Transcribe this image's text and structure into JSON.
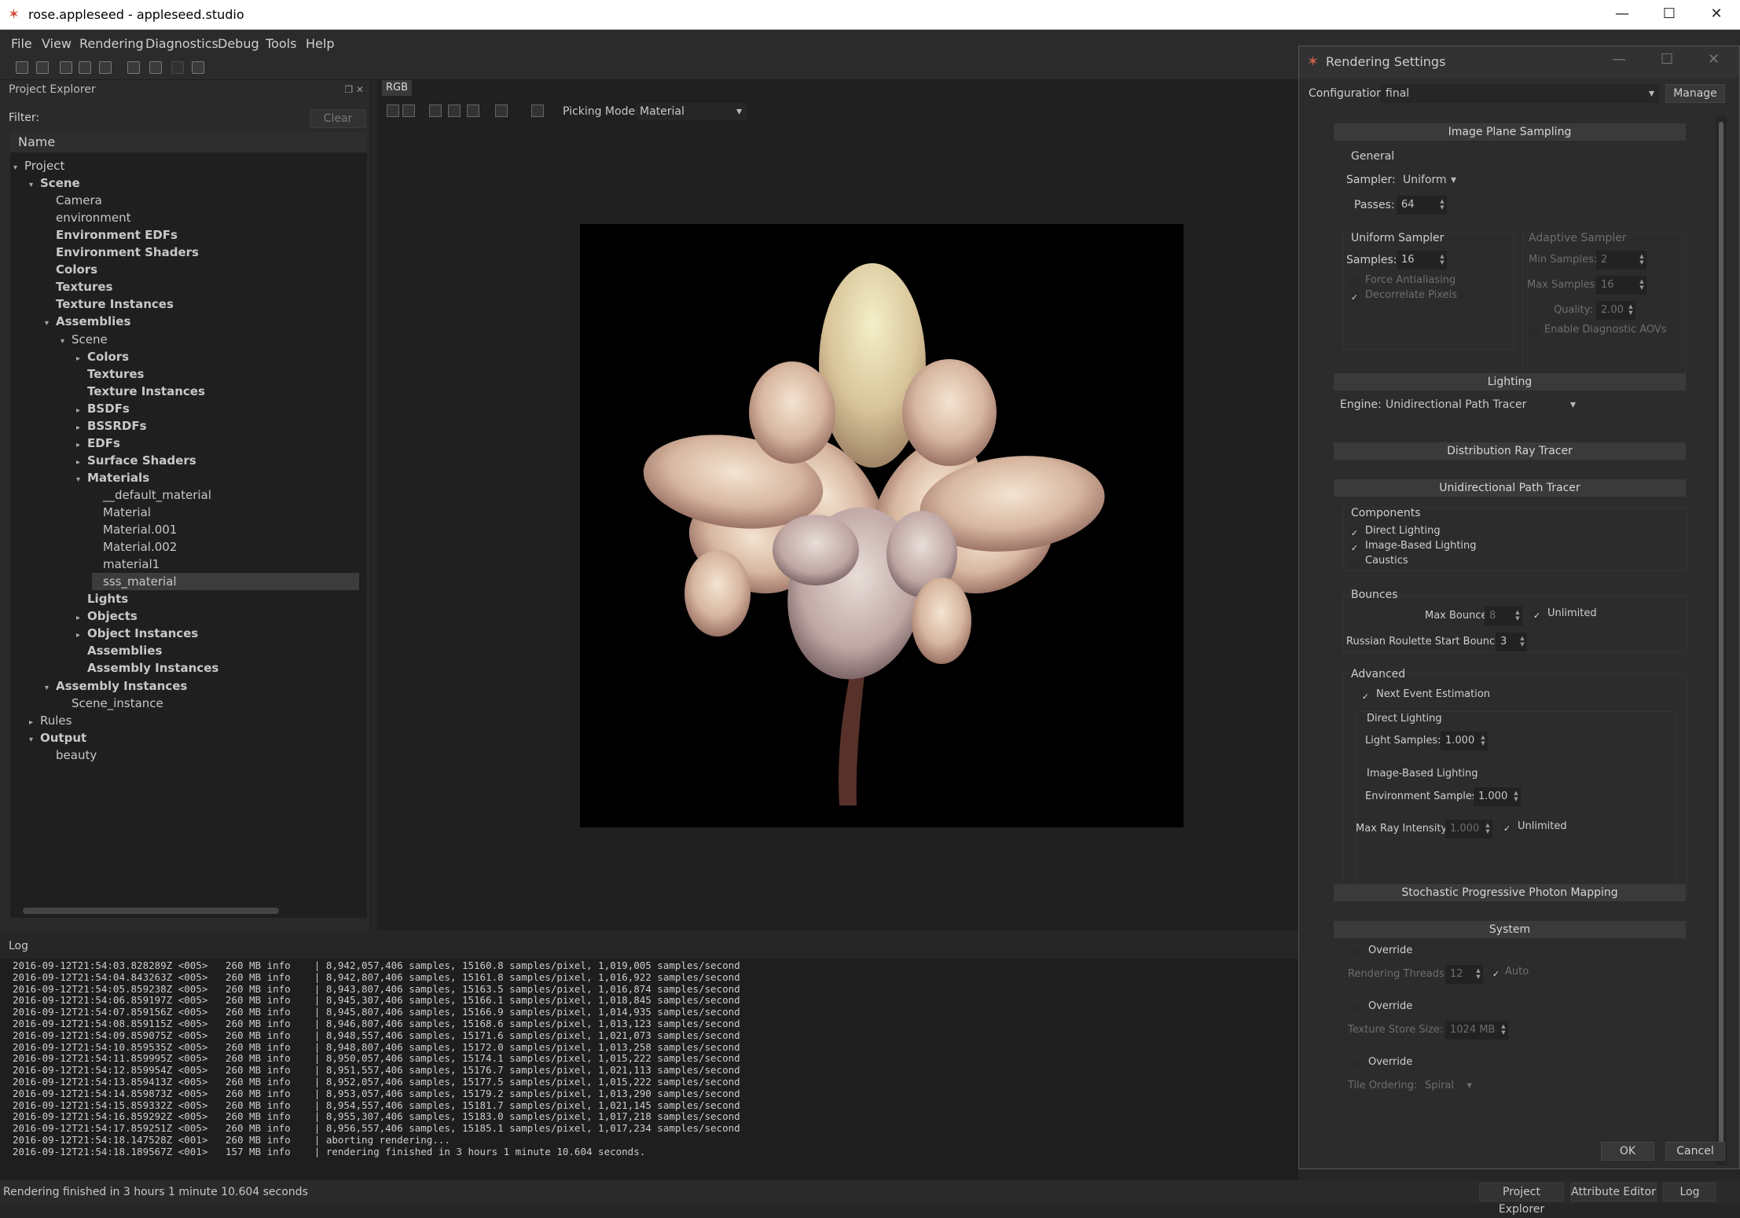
{
  "window": {
    "title": "rose.appleseed - appleseed.studio",
    "min": "—",
    "max": "☐",
    "close": "✕"
  },
  "menu": [
    "File",
    "View",
    "Rendering",
    "Diagnostics",
    "Debug",
    "Tools",
    "Help"
  ],
  "project_explorer": {
    "title": "Project Explorer",
    "filter_label": "Filter:",
    "filter_value": "",
    "clear_label": "Clear",
    "column": "Name",
    "tree": [
      {
        "label": "Project",
        "bold": false,
        "depth": 0,
        "arrow": "▾"
      },
      {
        "label": "Scene",
        "bold": true,
        "depth": 1,
        "arrow": "▾"
      },
      {
        "label": "Camera",
        "bold": false,
        "depth": 2,
        "arrow": ""
      },
      {
        "label": "environment",
        "bold": false,
        "depth": 2,
        "arrow": ""
      },
      {
        "label": "Environment EDFs",
        "bold": true,
        "depth": 2,
        "arrow": ""
      },
      {
        "label": "Environment Shaders",
        "bold": true,
        "depth": 2,
        "arrow": ""
      },
      {
        "label": "Colors",
        "bold": true,
        "depth": 2,
        "arrow": ""
      },
      {
        "label": "Textures",
        "bold": true,
        "depth": 2,
        "arrow": ""
      },
      {
        "label": "Texture Instances",
        "bold": true,
        "depth": 2,
        "arrow": ""
      },
      {
        "label": "Assemblies",
        "bold": true,
        "depth": 2,
        "arrow": "▾"
      },
      {
        "label": "Scene",
        "bold": false,
        "depth": 3,
        "arrow": "▾"
      },
      {
        "label": "Colors",
        "bold": true,
        "depth": 4,
        "arrow": "▸"
      },
      {
        "label": "Textures",
        "bold": true,
        "depth": 4,
        "arrow": ""
      },
      {
        "label": "Texture Instances",
        "bold": true,
        "depth": 4,
        "arrow": ""
      },
      {
        "label": "BSDFs",
        "bold": true,
        "depth": 4,
        "arrow": "▸"
      },
      {
        "label": "BSSRDFs",
        "bold": true,
        "depth": 4,
        "arrow": "▸"
      },
      {
        "label": "EDFs",
        "bold": true,
        "depth": 4,
        "arrow": "▸"
      },
      {
        "label": "Surface Shaders",
        "bold": true,
        "depth": 4,
        "arrow": "▸"
      },
      {
        "label": "Materials",
        "bold": true,
        "depth": 4,
        "arrow": "▾"
      },
      {
        "label": "__default_material",
        "bold": false,
        "depth": 5,
        "arrow": ""
      },
      {
        "label": "Material",
        "bold": false,
        "depth": 5,
        "arrow": ""
      },
      {
        "label": "Material.001",
        "bold": false,
        "depth": 5,
        "arrow": ""
      },
      {
        "label": "Material.002",
        "bold": false,
        "depth": 5,
        "arrow": ""
      },
      {
        "label": "material1",
        "bold": false,
        "depth": 5,
        "arrow": ""
      },
      {
        "label": "sss_material",
        "bold": false,
        "depth": 5,
        "arrow": "",
        "selected": true
      },
      {
        "label": "Lights",
        "bold": true,
        "depth": 4,
        "arrow": ""
      },
      {
        "label": "Objects",
        "bold": true,
        "depth": 4,
        "arrow": "▸"
      },
      {
        "label": "Object Instances",
        "bold": true,
        "depth": 4,
        "arrow": "▸"
      },
      {
        "label": "Assemblies",
        "bold": true,
        "depth": 4,
        "arrow": ""
      },
      {
        "label": "Assembly Instances",
        "bold": true,
        "depth": 4,
        "arrow": ""
      },
      {
        "label": "Assembly Instances",
        "bold": true,
        "depth": 2,
        "arrow": "▾"
      },
      {
        "label": "Scene_instance",
        "bold": false,
        "depth": 3,
        "arrow": ""
      },
      {
        "label": "Rules",
        "bold": false,
        "depth": 1,
        "arrow": "▸"
      },
      {
        "label": "Output",
        "bold": true,
        "depth": 1,
        "arrow": "▾"
      },
      {
        "label": "beauty",
        "bold": false,
        "depth": 2,
        "arrow": ""
      }
    ]
  },
  "viewport": {
    "tab": "RGB",
    "picking_label": "Picking Mode:",
    "picking_value": "Material"
  },
  "log": {
    "title": "Log",
    "lines": [
      "2016-09-12T21:54:03.828289Z <005>   260 MB info    | 8,942,057,406 samples, 15160.8 samples/pixel, 1,019,005 samples/second",
      "2016-09-12T21:54:04.843263Z <005>   260 MB info    | 8,942,807,406 samples, 15161.8 samples/pixel, 1,016,922 samples/second",
      "2016-09-12T21:54:05.859238Z <005>   260 MB info    | 8,943,807,406 samples, 15163.5 samples/pixel, 1,016,874 samples/second",
      "2016-09-12T21:54:06.859197Z <005>   260 MB info    | 8,945,307,406 samples, 15166.1 samples/pixel, 1,018,845 samples/second",
      "2016-09-12T21:54:07.859156Z <005>   260 MB info    | 8,945,807,406 samples, 15166.9 samples/pixel, 1,014,935 samples/second",
      "2016-09-12T21:54:08.859115Z <005>   260 MB info    | 8,946,807,406 samples, 15168.6 samples/pixel, 1,013,123 samples/second",
      "2016-09-12T21:54:09.859075Z <005>   260 MB info    | 8,948,557,406 samples, 15171.6 samples/pixel, 1,021,073 samples/second",
      "2016-09-12T21:54:10.859535Z <005>   260 MB info    | 8,948,807,406 samples, 15172.0 samples/pixel, 1,013,258 samples/second",
      "2016-09-12T21:54:11.859995Z <005>   260 MB info    | 8,950,057,406 samples, 15174.1 samples/pixel, 1,015,222 samples/second",
      "2016-09-12T21:54:12.859954Z <005>   260 MB info    | 8,951,557,406 samples, 15176.7 samples/pixel, 1,021,113 samples/second",
      "2016-09-12T21:54:13.859413Z <005>   260 MB info    | 8,952,057,406 samples, 15177.5 samples/pixel, 1,015,222 samples/second",
      "2016-09-12T21:54:14.859873Z <005>   260 MB info    | 8,953,057,406 samples, 15179.2 samples/pixel, 1,013,290 samples/second",
      "2016-09-12T21:54:15.859332Z <005>   260 MB info    | 8,954,557,406 samples, 15181.7 samples/pixel, 1,021,145 samples/second",
      "2016-09-12T21:54:16.859292Z <005>   260 MB info    | 8,955,307,406 samples, 15183.0 samples/pixel, 1,017,218 samples/second",
      "2016-09-12T21:54:17.859251Z <005>   260 MB info    | 8,956,557,406 samples, 15185.1 samples/pixel, 1,017,234 samples/second",
      "2016-09-12T21:54:18.147528Z <001>   260 MB info    | aborting rendering...",
      "2016-09-12T21:54:18.189567Z <001>   157 MB info    | rendering finished in 3 hours 1 minute 10.604 seconds."
    ]
  },
  "status": {
    "message": "Rendering finished in 3 hours 1 minute 10.604 seconds",
    "buttons": [
      "Project Explorer",
      "Attribute Editor",
      "Log"
    ]
  },
  "settings": {
    "title": "Rendering Settings",
    "config_label": "Configuration:",
    "config_value": "final",
    "manage": "Manage",
    "image_plane": {
      "header": "Image Plane Sampling",
      "general": "General",
      "sampler_label": "Sampler:",
      "sampler_value": "Uniform",
      "passes_label": "Passes:",
      "passes_value": "64",
      "uniform_title": "Uniform Sampler",
      "samples_label": "Samples:",
      "samples_value": "16",
      "force_aa": "Force Antialiasing",
      "decorrelate": "Decorrelate Pixels",
      "adaptive_title": "Adaptive Sampler",
      "min_samples_label": "Min Samples:",
      "min_samples_value": "2",
      "max_samples_label": "Max Samples:",
      "max_samples_value": "16",
      "quality_label": "Quality:",
      "quality_value": "2.00",
      "diag_aovs": "Enable Diagnostic AOVs"
    },
    "lighting": {
      "header": "Lighting",
      "engine_label": "Engine:",
      "engine_value": "Unidirectional Path Tracer"
    },
    "drt_header": "Distribution Ray Tracer",
    "upt": {
      "header": "Unidirectional Path Tracer",
      "components": "Components",
      "direct": "Direct Lighting",
      "ibl": "Image-Based Lighting",
      "caustics": "Caustics",
      "bounces": "Bounces",
      "max_bounces_label": "Max Bounces:",
      "max_bounces_value": "8",
      "unlimited": "Unlimited",
      "rr_label": "Russian Roulette Start Bounce:",
      "rr_value": "3",
      "advanced": "Advanced",
      "nee": "Next Event Estimation",
      "dl_title": "Direct Lighting",
      "light_samples_label": "Light Samples:",
      "light_samples_value": "1.000",
      "ibl_title": "Image-Based Lighting",
      "env_samples_label": "Environment Samples:",
      "env_samples_value": "1.000",
      "max_ray_label": "Max Ray Intensity:",
      "max_ray_value": "1.000",
      "max_ray_unlimited": "Unlimited"
    },
    "sppm_header": "Stochastic Progressive Photon Mapping",
    "system": {
      "header": "System",
      "override": "Override",
      "threads_label": "Rendering Threads:",
      "threads_value": "12",
      "auto": "Auto",
      "texture_label": "Texture Store Size:",
      "texture_value": "1024 MB",
      "tile_label": "Tile Ordering:",
      "tile_value": "Spiral"
    },
    "ok": "OK",
    "cancel": "Cancel"
  }
}
